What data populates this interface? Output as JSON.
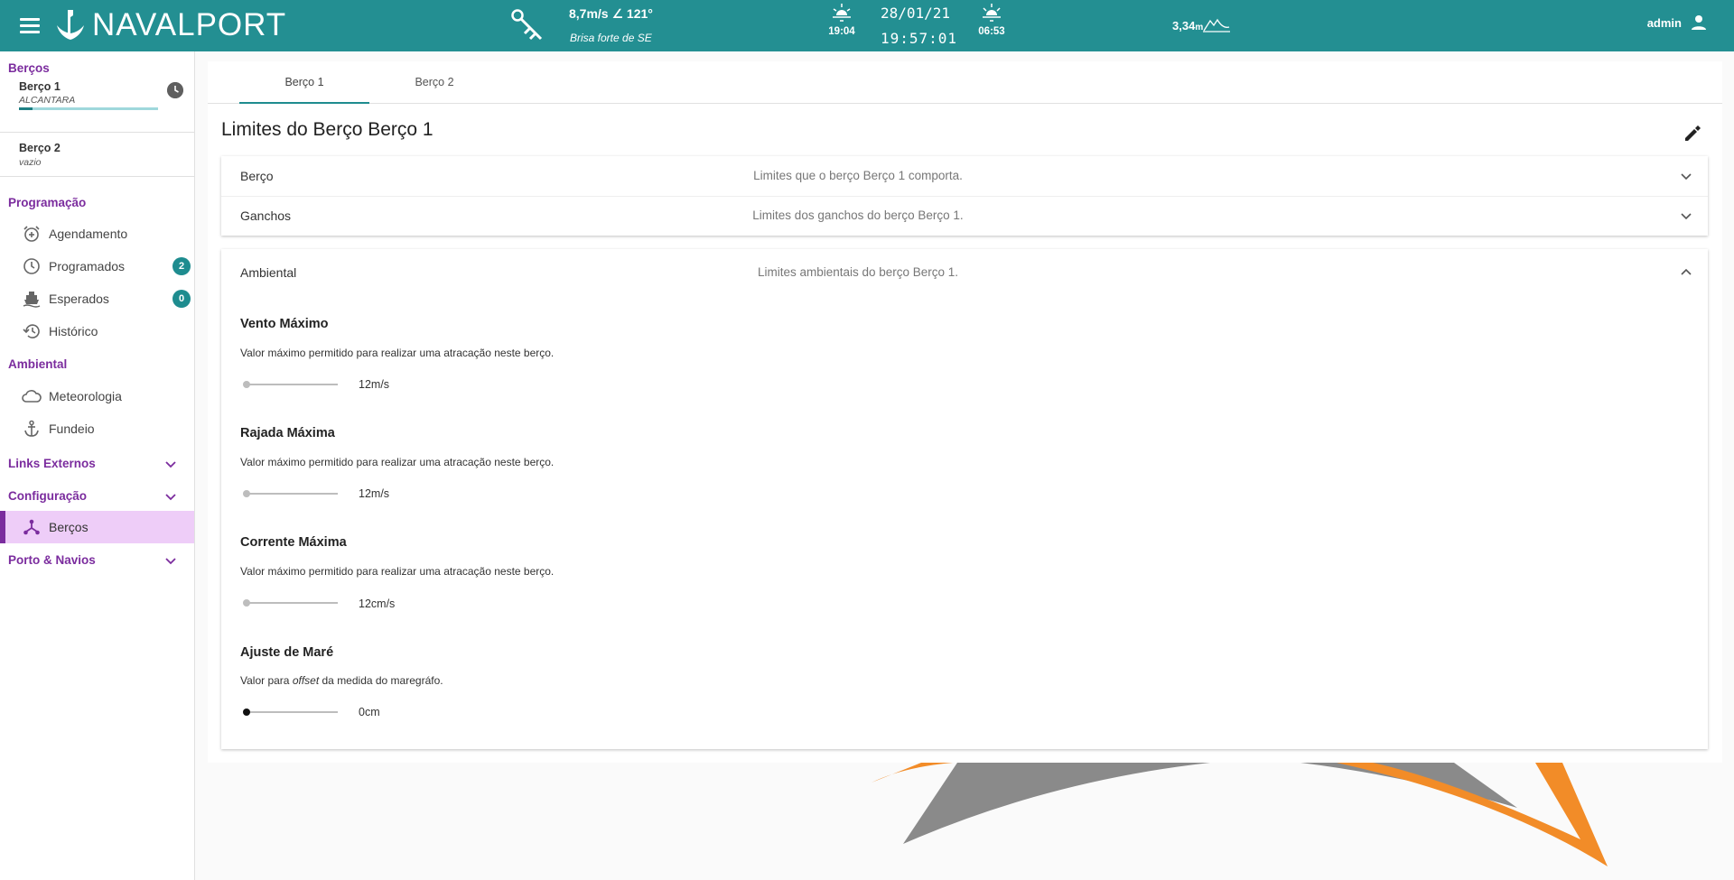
{
  "header": {
    "app_name": "NAVALPORT",
    "wind_speed_direction": "8,7m/s ∠ 121°",
    "wind_description": "Brisa forte de SE",
    "sunset_time": "19:04",
    "sunrise_time": "06:53",
    "date": "28/01/21",
    "time": "19:57:01",
    "tide_level": "3,34",
    "tide_unit": "m",
    "user_name": "admin",
    "colors": {
      "bar": "#238f92",
      "accent": "#7b2c9e"
    }
  },
  "sidebar": {
    "berths_title": "Berços",
    "berths": [
      {
        "name": "Berço 1",
        "ship": "ALCANTARA",
        "progress": 0.1
      },
      {
        "name": "Berço 2",
        "ship": "vazio"
      }
    ],
    "programacao": {
      "title": "Programação",
      "items": [
        {
          "label": "Agendamento",
          "icon": "alarm-add-icon"
        },
        {
          "label": "Programados",
          "icon": "clock-icon",
          "badge": "2"
        },
        {
          "label": "Esperados",
          "icon": "ship-icon",
          "badge": "0"
        },
        {
          "label": "Histórico",
          "icon": "history-icon"
        }
      ]
    },
    "ambiental": {
      "title": "Ambiental",
      "items": [
        {
          "label": "Meteorologia",
          "icon": "cloud-icon"
        },
        {
          "label": "Fundeio",
          "icon": "anchor-icon"
        }
      ]
    },
    "links_externos": "Links Externos",
    "configuracao": {
      "title": "Configuração",
      "items": [
        {
          "label": "Berços",
          "icon": "berth-network-icon",
          "active": true
        }
      ]
    },
    "porto_navios": "Porto & Navios"
  },
  "main": {
    "tabs": [
      {
        "label": "Berço 1",
        "active": true
      },
      {
        "label": "Berço 2",
        "active": false
      }
    ],
    "title": "Limites do Berço Berço 1",
    "panels": [
      {
        "title": "Berço",
        "description": "Limites que o berço Berço 1 comporta.",
        "expanded": false
      },
      {
        "title": "Ganchos",
        "description": "Limites dos ganchos do berço Berço 1.",
        "expanded": false
      },
      {
        "title": "Ambiental",
        "description": "Limites ambientais do berço Berço 1.",
        "expanded": true
      }
    ],
    "limits": [
      {
        "title": "Vento Máximo",
        "description": "Valor máximo permitido para realizar uma atracação neste berço.",
        "value": "12m/s"
      },
      {
        "title": "Rajada Máxima",
        "description": "Valor máximo permitido para realizar uma atracação neste berço.",
        "value": "12m/s"
      },
      {
        "title": "Corrente Máxima",
        "description": "Valor máximo permitido para realizar uma atracação neste berço.",
        "value": "12cm/s"
      },
      {
        "title": "Ajuste de Maré",
        "description_pre": "Valor para ",
        "description_em": "offset",
        "description_post": " da medida do maregráfo.",
        "value": "0cm"
      }
    ]
  }
}
